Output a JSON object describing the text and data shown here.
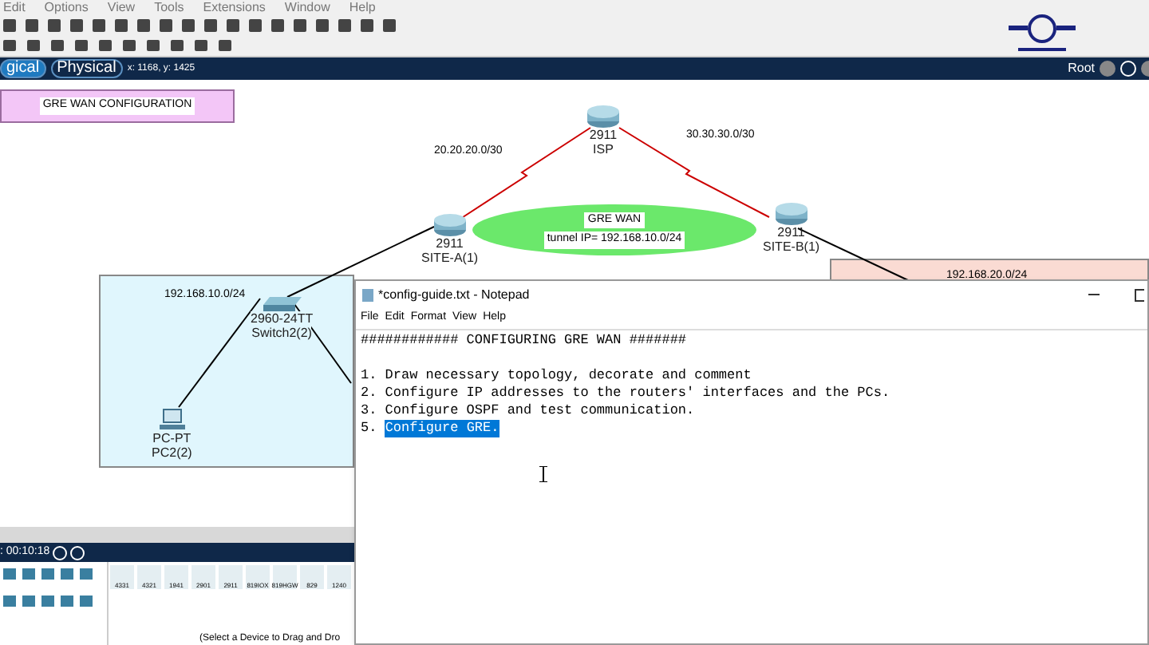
{
  "menu": [
    "Edit",
    "Options",
    "View",
    "Tools",
    "Extensions",
    "Window",
    "Help"
  ],
  "view_tabs": [
    {
      "label": "gical",
      "selected": true
    },
    {
      "label": "Physical",
      "selected": false
    }
  ],
  "coordinates": "x: 1168, y: 1425",
  "location": "Root",
  "canvas": {
    "note": "GRE WAN CONFIGURATION",
    "link_labels": [
      "20.20.20.0/30",
      "30.30.30.0/30"
    ],
    "areas": [
      {
        "label": "192.168.10.0/24",
        "color": "#e0f6fd"
      },
      {
        "label": "192.168.20.0/24",
        "color": "#fadbd3"
      }
    ],
    "tunnel": {
      "title": "GRE WAN",
      "text": "tunnel IP= 192.168.10.0/24"
    },
    "devices": [
      {
        "kind": "router",
        "model": "2911",
        "name": "ISP"
      },
      {
        "kind": "router",
        "model": "2911",
        "name": "SITE-A(1)"
      },
      {
        "kind": "router",
        "model": "2911",
        "name": "SITE-B(1)"
      },
      {
        "kind": "switch",
        "model": "2960-24TT",
        "name": "Switch2(2)"
      },
      {
        "kind": "pc",
        "model": "PC-PT",
        "name": "PC2(2)"
      }
    ]
  },
  "time": ": 00:10:18",
  "palette": [
    "4331",
    "4321",
    "1941",
    "2901",
    "2911",
    "819IOX",
    "819HGW",
    "829",
    "1240"
  ],
  "status": "(Select a Device to Drag and Dro",
  "notepad": {
    "title": "*config-guide.txt - Notepad",
    "menu": [
      "File",
      "Edit",
      "Format",
      "View",
      "Help"
    ],
    "lines": [
      {
        "segments": [
          {
            "text": "############ CONFIGURING GRE WAN #######",
            "selected": false
          }
        ]
      },
      {
        "kind": "blank"
      },
      {
        "segments": [
          {
            "text": "1. Draw necessary topology, decorate and comment",
            "selected": false
          }
        ]
      },
      {
        "segments": [
          {
            "text": "2. Configure IP addresses to the routers' interfaces and the PCs.",
            "selected": false
          }
        ]
      },
      {
        "segments": [
          {
            "text": "3. Configure OSPF and test communication.",
            "selected": false
          }
        ]
      },
      {
        "segments": [
          {
            "text": "5. ",
            "selected": false
          },
          {
            "text": "Configure GRE.",
            "selected": true
          }
        ]
      }
    ]
  }
}
